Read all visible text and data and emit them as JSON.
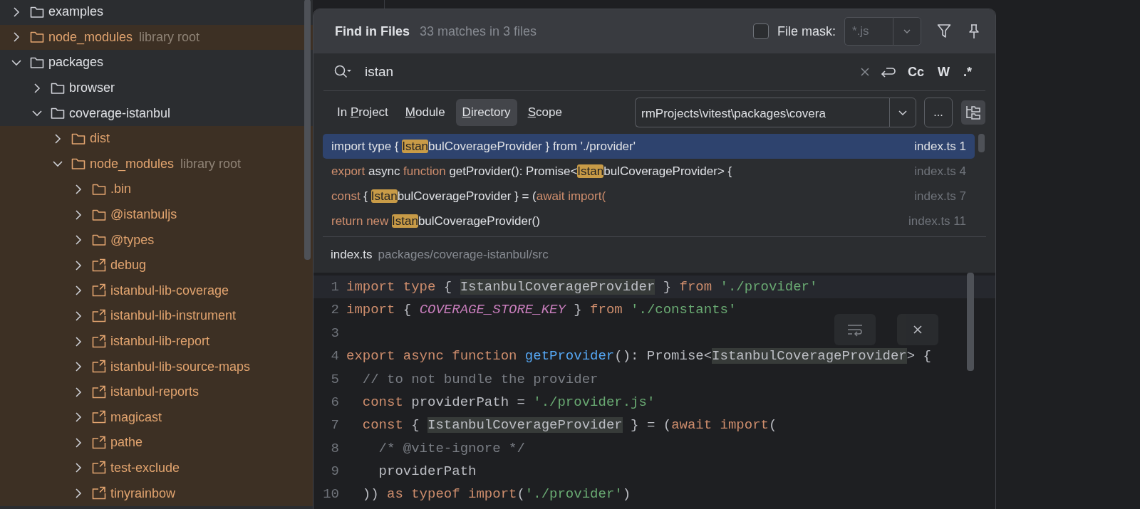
{
  "project_tree": {
    "items": [
      {
        "label": "examples",
        "kind": "folder",
        "expanded": false
      },
      {
        "label": "node_modules",
        "note": "library root",
        "kind": "excluded",
        "expanded": false
      },
      {
        "label": "packages",
        "kind": "folder",
        "expanded": true,
        "children": [
          {
            "label": "browser",
            "kind": "folder",
            "expanded": false
          },
          {
            "label": "coverage-istanbul",
            "kind": "folder",
            "expanded": true,
            "children": [
              {
                "label": "dist",
                "kind": "excluded",
                "expanded": false
              },
              {
                "label": "node_modules",
                "note": "library root",
                "kind": "excluded",
                "expanded": true,
                "children": [
                  {
                    "label": ".bin",
                    "kind": "excluded",
                    "expanded": false
                  },
                  {
                    "label": "@istanbuljs",
                    "kind": "excluded",
                    "expanded": false
                  },
                  {
                    "label": "@types",
                    "kind": "excluded",
                    "expanded": false
                  },
                  {
                    "label": "debug",
                    "kind": "link",
                    "expanded": false
                  },
                  {
                    "label": "istanbul-lib-coverage",
                    "kind": "link",
                    "expanded": false
                  },
                  {
                    "label": "istanbul-lib-instrument",
                    "kind": "link",
                    "expanded": false
                  },
                  {
                    "label": "istanbul-lib-report",
                    "kind": "link",
                    "expanded": false
                  },
                  {
                    "label": "istanbul-lib-source-maps",
                    "kind": "link",
                    "expanded": false
                  },
                  {
                    "label": "istanbul-reports",
                    "kind": "link",
                    "expanded": false
                  },
                  {
                    "label": "magicast",
                    "kind": "link",
                    "expanded": false
                  },
                  {
                    "label": "pathe",
                    "kind": "link",
                    "expanded": false
                  },
                  {
                    "label": "test-exclude",
                    "kind": "link",
                    "expanded": false
                  },
                  {
                    "label": "tinyrainbow",
                    "kind": "link",
                    "expanded": false
                  }
                ]
              }
            ]
          }
        ]
      }
    ]
  },
  "find_popup": {
    "title": "Find in Files",
    "summary": "33 matches in 3 files",
    "file_mask": {
      "label": "File mask:",
      "checked": false,
      "placeholder": "*.js"
    },
    "search": {
      "value": "istan"
    },
    "options": [
      {
        "label": "Cc",
        "selected": false
      },
      {
        "label": "W",
        "selected": false
      },
      {
        "label": ".*",
        "selected": false
      }
    ],
    "scopes": [
      {
        "prefix": "In ",
        "mnemonic": "P",
        "rest": "roject",
        "selected": false
      },
      {
        "mnemonic": "M",
        "rest": "odule",
        "selected": false
      },
      {
        "mnemonic": "D",
        "rest": "irectory",
        "selected": true
      },
      {
        "mnemonic": "S",
        "rest": "cope",
        "selected": false
      }
    ],
    "directory": {
      "value": "rmProjects\\vitest\\packages\\covera",
      "browse": "..."
    },
    "results": [
      {
        "selected": true,
        "file": "index.ts",
        "line": "1",
        "segments": [
          {
            "kind": "keyword",
            "text": "import type"
          },
          {
            "kind": "plain",
            "text": " { "
          },
          {
            "kind": "match",
            "text": "Istan"
          },
          {
            "kind": "plain",
            "text": "bulCoverageProvider } "
          },
          {
            "kind": "keyword",
            "text": "from"
          },
          {
            "kind": "plain",
            "text": " './provider'"
          }
        ]
      },
      {
        "selected": false,
        "file": "index.ts",
        "line": "4",
        "segments": [
          {
            "kind": "keyword",
            "text": "export"
          },
          {
            "kind": "plain",
            "text": " async "
          },
          {
            "kind": "keyword",
            "text": "function"
          },
          {
            "kind": "plain",
            "text": " getProvider(): Promise<"
          },
          {
            "kind": "match",
            "text": "Istan"
          },
          {
            "kind": "plain",
            "text": "bulCoverageProvider> {"
          }
        ]
      },
      {
        "selected": false,
        "file": "index.ts",
        "line": "7",
        "segments": [
          {
            "kind": "keyword",
            "text": "const"
          },
          {
            "kind": "plain",
            "text": " { "
          },
          {
            "kind": "match",
            "text": "Istan"
          },
          {
            "kind": "plain",
            "text": "bulCoverageProvider } = ("
          },
          {
            "kind": "keyword",
            "text": "await import("
          }
        ]
      },
      {
        "selected": false,
        "file": "index.ts",
        "line": "11",
        "segments": [
          {
            "kind": "keyword",
            "text": "return new "
          },
          {
            "kind": "match",
            "text": "Istan"
          },
          {
            "kind": "plain",
            "text": "bulCoverageProvider()"
          }
        ]
      }
    ],
    "preview": {
      "file": "index.ts",
      "path": "packages/coverage-istanbul/src",
      "lines": [
        {
          "number": "1",
          "current": true,
          "tokens": [
            {
              "kind": "keyword",
              "text": "import type"
            },
            {
              "kind": "plain",
              "text": " { "
            },
            {
              "kind": "usage",
              "text": "IstanbulCoverageProvider"
            },
            {
              "kind": "plain",
              "text": " } "
            },
            {
              "kind": "keyword",
              "text": "from "
            },
            {
              "kind": "string",
              "text": "'./provider'"
            }
          ]
        },
        {
          "number": "2",
          "current": false,
          "tokens": [
            {
              "kind": "keyword",
              "text": "import"
            },
            {
              "kind": "plain",
              "text": " { "
            },
            {
              "kind": "constant",
              "text": "COVERAGE_STORE_KEY"
            },
            {
              "kind": "plain",
              "text": " } "
            },
            {
              "kind": "keyword",
              "text": "from "
            },
            {
              "kind": "string",
              "text": "'./constants'"
            }
          ]
        },
        {
          "number": "3",
          "current": false
        },
        {
          "number": "4",
          "current": false,
          "tokens": [
            {
              "kind": "keyword",
              "text": "export async function "
            },
            {
              "kind": "function",
              "text": "getProvider"
            },
            {
              "kind": "plain",
              "text": "(): Promise<"
            },
            {
              "kind": "usage",
              "text": "IstanbulCoverageProvider"
            },
            {
              "kind": "plain",
              "text": "> {"
            }
          ]
        },
        {
          "number": "5",
          "current": false,
          "tokens": [
            {
              "kind": "comment",
              "text": "  // to not bundle the provider"
            }
          ]
        },
        {
          "number": "6",
          "current": false,
          "tokens": [
            {
              "kind": "keyword",
              "text": "  const"
            },
            {
              "kind": "plain",
              "text": " providerPath = "
            },
            {
              "kind": "string",
              "text": "'./provider.js'"
            }
          ]
        },
        {
          "number": "7",
          "current": false,
          "tokens": [
            {
              "kind": "keyword",
              "text": "  const"
            },
            {
              "kind": "plain",
              "text": " { "
            },
            {
              "kind": "usage",
              "text": "IstanbulCoverageProvider"
            },
            {
              "kind": "plain",
              "text": " } = ("
            },
            {
              "kind": "keyword",
              "text": "await import"
            },
            {
              "kind": "plain",
              "text": "("
            }
          ]
        },
        {
          "number": "8",
          "current": false,
          "tokens": [
            {
              "kind": "comment",
              "text": "    /* @vite-ignore */"
            }
          ]
        },
        {
          "number": "9",
          "current": false,
          "tokens": [
            {
              "kind": "plain",
              "text": "    providerPath"
            }
          ]
        },
        {
          "number": "10",
          "current": false,
          "tokens": [
            {
              "kind": "plain",
              "text": "  )) "
            },
            {
              "kind": "keyword",
              "text": "as typeof import"
            },
            {
              "kind": "plain",
              "text": "("
            },
            {
              "kind": "string",
              "text": "'./provider'"
            },
            {
              "kind": "plain",
              "text": ")"
            }
          ]
        }
      ]
    }
  }
}
